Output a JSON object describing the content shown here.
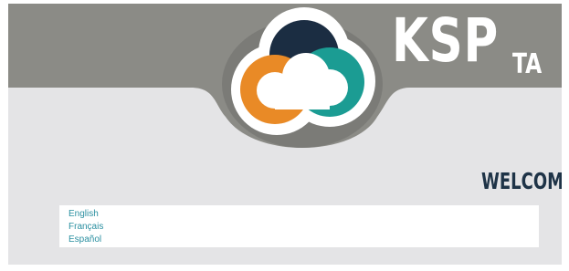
{
  "brand": {
    "name": "KSP",
    "suffix": "TA",
    "logo_icon": "cloud-logo-icon",
    "colors": {
      "header_gray": "#8b8b86",
      "page_bg": "#e4e4e6",
      "navy": "#1b2d42",
      "orange": "#e98a26",
      "teal": "#1b9c93",
      "link_teal": "#2a8fa0"
    }
  },
  "welcome": {
    "title": "WELCOME"
  },
  "languages": [
    {
      "label": "English"
    },
    {
      "label": "Français"
    },
    {
      "label": "Español"
    }
  ]
}
